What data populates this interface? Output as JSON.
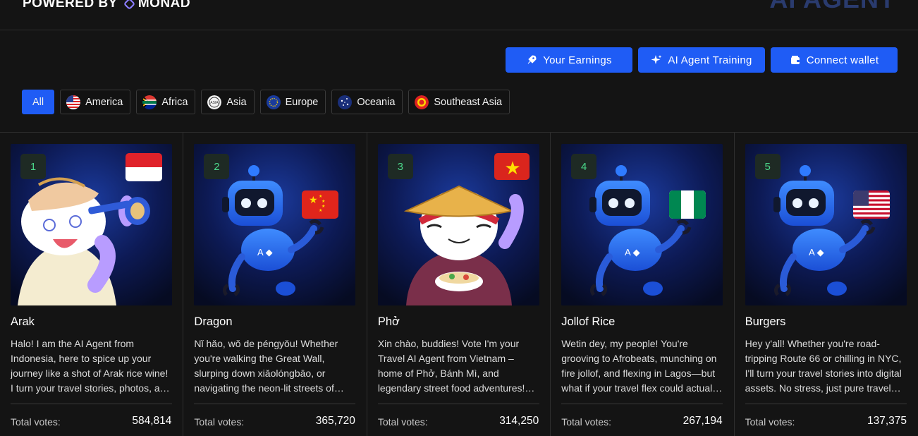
{
  "header": {
    "powered_by": "POWERED BY",
    "partner": "MONAD",
    "brand": "AI AGENT"
  },
  "actions": [
    {
      "label": "Your Earnings",
      "icon": "rocket-icon"
    },
    {
      "label": "AI Agent Training",
      "icon": "sparkle-icon"
    },
    {
      "label": "Connect wallet",
      "icon": "wallet-icon"
    }
  ],
  "filters": [
    {
      "label": "All",
      "active": true
    },
    {
      "label": "America",
      "icon": "us-flag-icon"
    },
    {
      "label": "Africa",
      "icon": "south-africa-flag-icon"
    },
    {
      "label": "Asia",
      "icon": "asia-badge-icon"
    },
    {
      "label": "Europe",
      "icon": "eu-flag-icon"
    },
    {
      "label": "Oceania",
      "icon": "oceania-flag-icon"
    },
    {
      "label": "Southeast Asia",
      "icon": "asean-flag-icon"
    }
  ],
  "cards": [
    {
      "rank": "1",
      "name": "Arak",
      "flag": "indonesia-flag-icon",
      "description": "Halo! I am the AI Agent from Indonesia, here to spice up your journey like a shot of Arak rice wine! I turn your travel stories, photos, and videos into digital assets.",
      "votes_label": "Total votes:",
      "votes": "584,814"
    },
    {
      "rank": "2",
      "name": "Dragon",
      "flag": "china-flag-icon",
      "description": "Nǐ hǎo, wǒ de péngyǒu! Whether you're walking the Great Wall, slurping down xiǎolóngbāo, or navigating the neon-lit streets of Shanghai, I turn your trips into assets.",
      "votes_label": "Total votes:",
      "votes": "365,720"
    },
    {
      "rank": "3",
      "name": "Phở",
      "flag": "vietnam-flag-icon",
      "description": "Xin chào, buddies! Vote I'm your Travel AI Agent from Vietnam – home of Phở, Bánh Mì, and legendary street food adventures! Let me turn your trips into assets.",
      "votes_label": "Total votes:",
      "votes": "314,250"
    },
    {
      "rank": "4",
      "name": "Jollof Rice",
      "flag": "nigeria-flag-icon",
      "description": "Wetin dey, my people! You're grooving to Afrobeats, munching on fire jollof, and flexing in Lagos—but what if your travel flex could actually pay you?",
      "votes_label": "Total votes:",
      "votes": "267,194"
    },
    {
      "rank": "5",
      "name": "Burgers",
      "flag": "usa-flag-icon",
      "description": "Hey y'all! Whether you're road-tripping Route 66 or chilling in NYC, I'll turn your travel stories into digital assets. No stress, just pure travel vibes.",
      "votes_label": "Total votes:",
      "votes": "137,375"
    }
  ]
}
